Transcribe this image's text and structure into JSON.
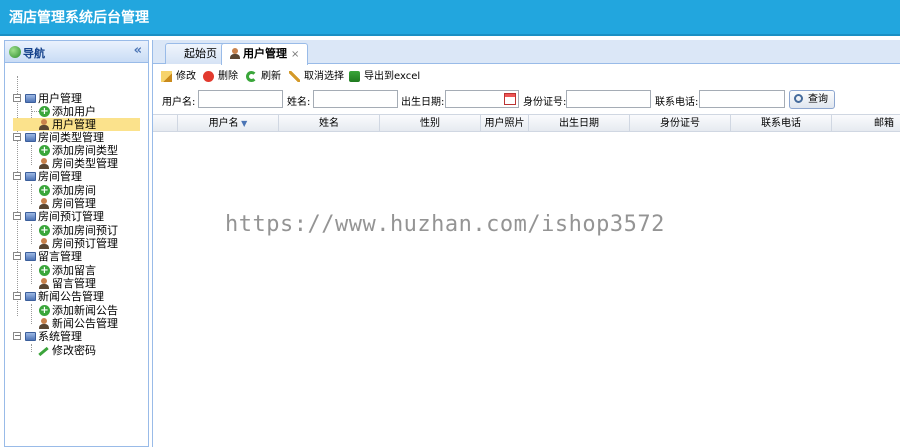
{
  "app": {
    "title": "酒店管理系统后台管理"
  },
  "nav": {
    "title": "导航",
    "collapse_glyph": "«",
    "groups": [
      {
        "label": "用户管理",
        "children": [
          "添加用户",
          "用户管理"
        ]
      },
      {
        "label": "房间类型管理",
        "children": [
          "添加房间类型",
          "房间类型管理"
        ]
      },
      {
        "label": "房间管理",
        "children": [
          "添加房间",
          "房间管理"
        ]
      },
      {
        "label": "房间预订管理",
        "children": [
          "添加房间预订",
          "房间预订管理"
        ]
      },
      {
        "label": "留言管理",
        "children": [
          "添加留言",
          "留言管理"
        ]
      },
      {
        "label": "新闻公告管理",
        "children": [
          "添加新闻公告",
          "新闻公告管理"
        ]
      },
      {
        "label": "系统管理",
        "children": [
          "修改密码"
        ]
      }
    ]
  },
  "tabs": [
    {
      "label": "起始页"
    },
    {
      "label": "用户管理",
      "close": "×"
    }
  ],
  "toolbar": {
    "edit": "修改",
    "delete": "删除",
    "refresh": "刷新",
    "deselect": "取消选择",
    "export": "导出到excel"
  },
  "search": {
    "username_label": "用户名:",
    "name_label": "姓名:",
    "birth_label": "出生日期:",
    "idcard_label": "身份证号:",
    "phone_label": "联系电话:",
    "query_button": "查询"
  },
  "grid": {
    "columns": [
      "用户名",
      "姓名",
      "性别",
      "用户照片",
      "出生日期",
      "身份证号",
      "联系电话",
      "邮箱"
    ]
  },
  "watermark": "https://www.huzhan.com/ishop3572",
  "colors": {
    "header": "#22a6de",
    "selected": "#fbe28c",
    "border": "#99bbe8"
  }
}
